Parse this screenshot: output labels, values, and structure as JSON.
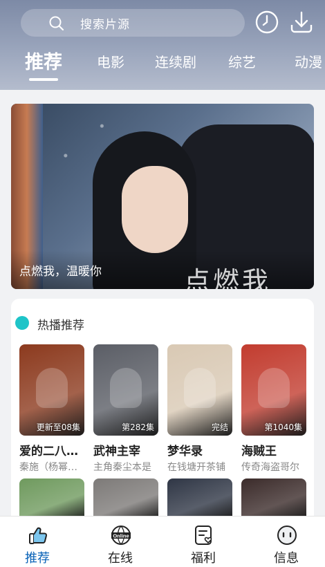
{
  "search": {
    "placeholder": "搜索片源"
  },
  "tabs": [
    {
      "label": "推荐",
      "active": true
    },
    {
      "label": "电影"
    },
    {
      "label": "连续剧"
    },
    {
      "label": "综艺"
    },
    {
      "label": "动漫"
    }
  ],
  "banner": {
    "title": "点燃我，温暖你",
    "art_text": "点燃我"
  },
  "section": {
    "title": "热播推荐"
  },
  "items": [
    {
      "title": "爱的二八定律",
      "subtitle": "秦施（杨幂饰）",
      "badge": "更新至08集",
      "color": "#8c3a1e"
    },
    {
      "title": "武神主宰",
      "subtitle": "主角秦尘本是",
      "badge": "第282集",
      "color": "#5b5e66"
    },
    {
      "title": "梦华录",
      "subtitle": "在钱塘开茶铺",
      "badge": "完结",
      "color": "#d9c9b4"
    },
    {
      "title": "海贼王",
      "subtitle": "传奇海盗哥尔",
      "badge": "第1040集",
      "color": "#c23c2f"
    }
  ],
  "row2_colors": [
    "#6f9a5e",
    "#7d7a78",
    "#2f3645",
    "#3b2b2a"
  ],
  "nav": [
    {
      "label": "推荐",
      "icon": "thumbs-up-icon",
      "active": true
    },
    {
      "label": "在线",
      "icon": "online-globe-icon",
      "icon_text": "Online"
    },
    {
      "label": "福利",
      "icon": "gift-card-icon"
    },
    {
      "label": "信息",
      "icon": "message-face-icon"
    }
  ],
  "colors": {
    "accent": "#1ec4c8",
    "active_nav": "#0a63b8"
  }
}
